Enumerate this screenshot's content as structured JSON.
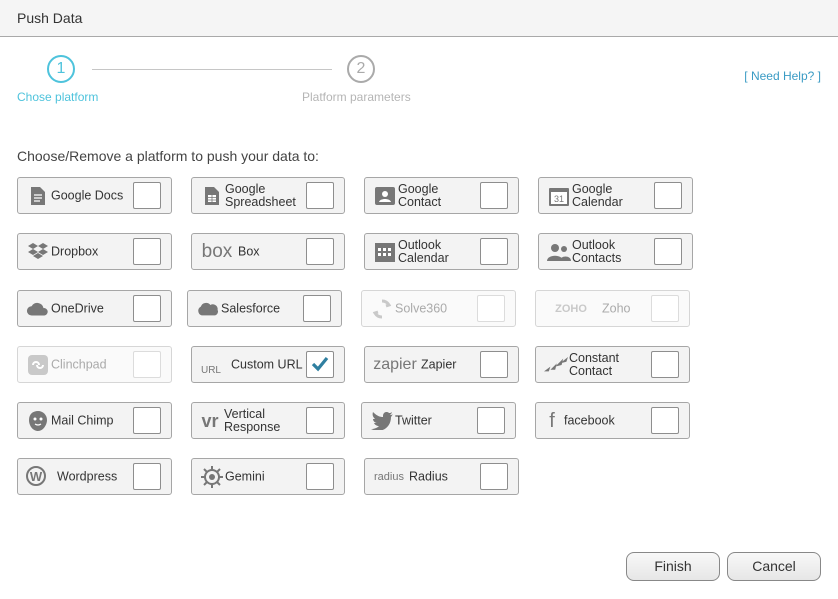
{
  "window": {
    "title": "Push Data"
  },
  "wizard": {
    "steps": [
      {
        "number": "1",
        "label": "Chose platform"
      },
      {
        "number": "2",
        "label": "Platform parameters"
      }
    ]
  },
  "help_link": "[ Need Help? ]",
  "instructions": "Choose/Remove a platform to push your data to:",
  "colors": {
    "accent": "#4ec3dc",
    "link": "#3a9bc4",
    "check": "#2f7fa0"
  },
  "platforms": [
    {
      "label": "Google Docs",
      "icon": "google-docs-icon",
      "checked": false,
      "disabled": false
    },
    {
      "label": "Google Spreadsheet",
      "icon": "google-spreadsheet-icon",
      "checked": false,
      "disabled": false
    },
    {
      "label": "Google Contact",
      "icon": "google-contact-icon",
      "checked": false,
      "disabled": false
    },
    {
      "label": "Google Calendar",
      "icon": "google-calendar-icon",
      "checked": false,
      "disabled": false
    },
    {
      "label": "Dropbox",
      "icon": "dropbox-icon",
      "checked": false,
      "disabled": false
    },
    {
      "label": "Box",
      "icon": "box-logo-icon",
      "icon_text": "box",
      "checked": false,
      "disabled": false
    },
    {
      "label": "Outlook Calendar",
      "icon": "outlook-calendar-icon",
      "checked": false,
      "disabled": false
    },
    {
      "label": "Outlook Contacts",
      "icon": "outlook-contacts-icon",
      "checked": false,
      "disabled": false
    },
    {
      "label": "OneDrive",
      "icon": "onedrive-icon",
      "checked": false,
      "disabled": false
    },
    {
      "label": "Salesforce",
      "icon": "salesforce-icon",
      "checked": false,
      "disabled": false
    },
    {
      "label": "Solve360",
      "icon": "solve360-icon",
      "checked": false,
      "disabled": true
    },
    {
      "label": "Zoho",
      "icon": "zoho-logo-icon",
      "icon_text": "ZOHO",
      "checked": false,
      "disabled": true
    },
    {
      "label": "Clinchpad",
      "icon": "clinchpad-icon",
      "checked": false,
      "disabled": true
    },
    {
      "label": "Custom URL",
      "icon": "custom-url-icon",
      "icon_text": "URL",
      "checked": true,
      "disabled": false
    },
    {
      "label": "Zapier",
      "icon": "zapier-logo-icon",
      "icon_text": "zapier",
      "checked": false,
      "disabled": false
    },
    {
      "label": "Constant Contact",
      "icon": "constant-contact-icon",
      "checked": false,
      "disabled": false
    },
    {
      "label": "Mail Chimp",
      "icon": "mailchimp-icon",
      "checked": false,
      "disabled": false
    },
    {
      "label": "Vertical Response",
      "icon": "vertical-response-icon",
      "icon_text": "vr",
      "checked": false,
      "disabled": false
    },
    {
      "label": "Twitter",
      "icon": "twitter-icon",
      "checked": false,
      "disabled": false
    },
    {
      "label": "facebook",
      "icon": "facebook-icon",
      "icon_text": "f",
      "checked": false,
      "disabled": false
    },
    {
      "label": "Wordpress",
      "icon": "wordpress-icon",
      "icon_text": "W",
      "checked": false,
      "disabled": false
    },
    {
      "label": "Gemini",
      "icon": "gemini-icon",
      "checked": false,
      "disabled": false
    },
    {
      "label": "Radius",
      "icon": "radius-logo-icon",
      "icon_text": "radius",
      "checked": false,
      "disabled": false
    }
  ],
  "buttons": {
    "finish": "Finish",
    "cancel": "Cancel"
  }
}
